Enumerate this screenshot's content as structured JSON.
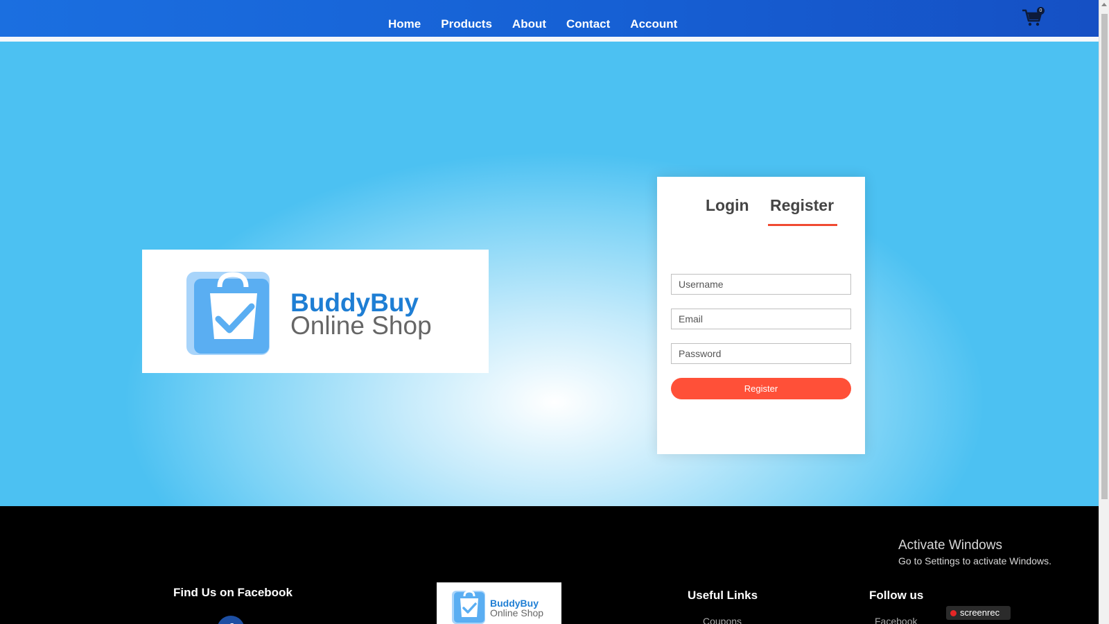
{
  "nav": {
    "links": [
      "Home",
      "Products",
      "About",
      "Contact",
      "Account"
    ],
    "cart_count": "0"
  },
  "hero": {
    "logo": {
      "brand": "BuddyBuy",
      "tagline": "Online Shop"
    }
  },
  "auth": {
    "tab_login": "Login",
    "tab_register": "Register",
    "username_placeholder": "Username",
    "email_placeholder": "Email",
    "password_placeholder": "Password",
    "register_button": "Register"
  },
  "footer": {
    "facebook_heading": "Find Us on Facebook",
    "logo": {
      "brand": "BuddyBuy",
      "tagline": "Online Shop"
    },
    "useful_links_heading": "Useful Links",
    "useful_links": [
      "Coupons"
    ],
    "follow_heading": "Follow us",
    "follow_links": [
      "Facebook"
    ]
  },
  "overlay": {
    "activate_title": "Activate Windows",
    "activate_sub": "Go to Settings to activate Windows.",
    "screenrec": "screenrec"
  },
  "colors": {
    "nav_blue": "#1660d4",
    "accent_red": "#ff5038",
    "brand_blue": "#1e7ed4"
  }
}
